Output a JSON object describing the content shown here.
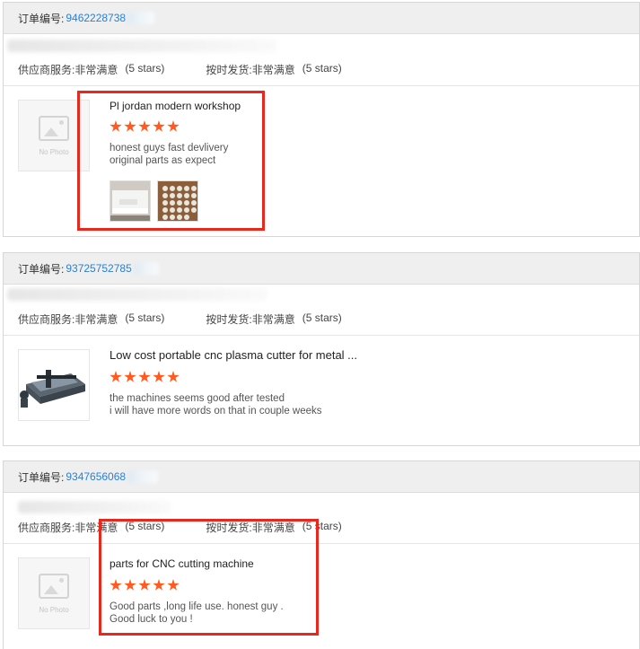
{
  "labels": {
    "order_no": "订单编号:",
    "supplier_service": "供应商服务:",
    "on_time_shipping": "按时发货:",
    "very_satisfied": "非常满意",
    "five_stars": "(5 stars)",
    "no_photo": "No Photo"
  },
  "orders": [
    {
      "order_number": "9462228738",
      "product_title": "Pl jordan modern workshop",
      "stars": 5,
      "review_line1": "honest guys fast devlivery",
      "review_line2": "original parts as expect",
      "thumbnail": "no-photo",
      "review_images": 2,
      "highlighted": true
    },
    {
      "order_number": "93725752785",
      "product_title": "Low cost portable cnc plasma cutter for metal ...",
      "stars": 5,
      "review_line1": "the machines seems good after tested",
      "review_line2": "i will have more words on that in couple weeks",
      "thumbnail": "cnc-plasma-cutter-photo",
      "review_images": 0,
      "highlighted": false
    },
    {
      "order_number": "9347656068",
      "product_title": "parts for CNC cutting machine",
      "stars": 5,
      "review_line1": "Good parts ,long life use. honest guy .",
      "review_line2": "Good luck to you !",
      "thumbnail": "no-photo",
      "review_images": 0,
      "highlighted": true
    }
  ],
  "colors": {
    "highlight_box": "#e8281c",
    "star": "#ff5a1f",
    "order_link": "#2a7fd4",
    "header_bg": "#efefef"
  }
}
